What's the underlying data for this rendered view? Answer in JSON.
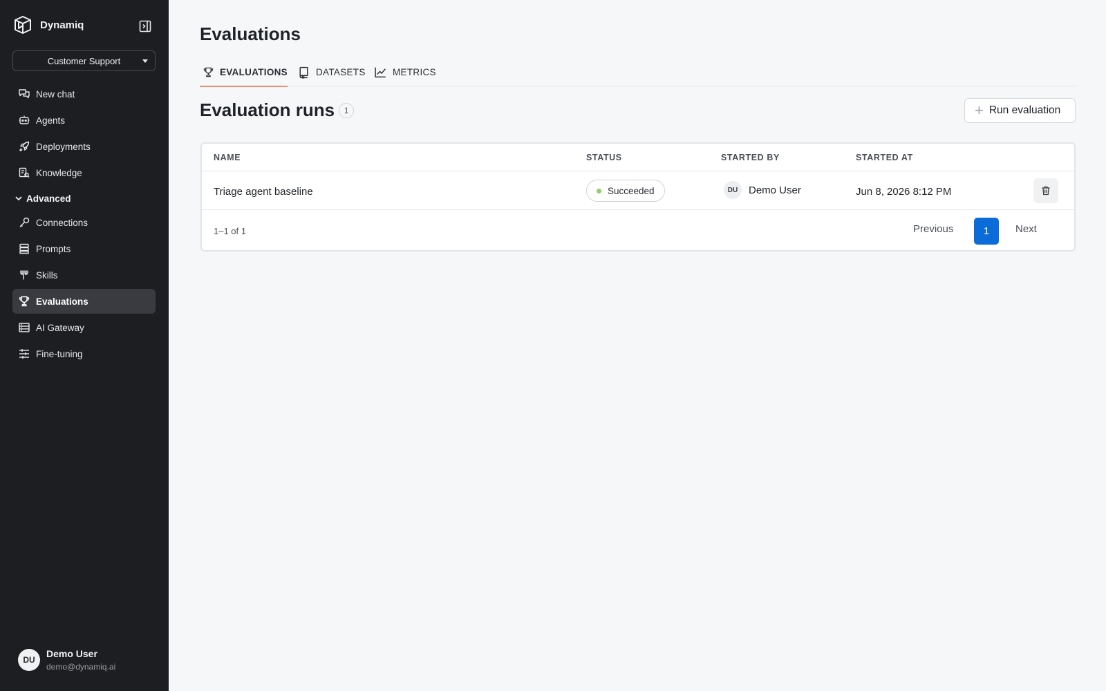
{
  "sidebar": {
    "brand": "Dynamiq",
    "project": "Customer Support",
    "nav_top": [
      {
        "label": "New chat",
        "icon": "chat-icon"
      },
      {
        "label": "Agents",
        "icon": "bot-icon"
      },
      {
        "label": "Deployments",
        "icon": "rocket-icon"
      },
      {
        "label": "Knowledge",
        "icon": "knowledge-icon"
      }
    ],
    "advanced_label": "Advanced",
    "nav_advanced": [
      {
        "label": "Connections",
        "icon": "key-icon"
      },
      {
        "label": "Prompts",
        "icon": "prompts-icon"
      },
      {
        "label": "Skills",
        "icon": "skills-icon"
      },
      {
        "label": "Evaluations",
        "icon": "trophy-icon",
        "active": true
      },
      {
        "label": "AI Gateway",
        "icon": "gateway-icon"
      },
      {
        "label": "Fine-tuning",
        "icon": "sliders-icon"
      }
    ],
    "user": {
      "initials": "DU",
      "name": "Demo User",
      "email": "demo@dynamiq.ai"
    }
  },
  "main": {
    "title": "Evaluations",
    "tabs": [
      {
        "label": "EVALUATIONS",
        "icon": "trophy-icon",
        "active": true
      },
      {
        "label": "DATASETS",
        "icon": "book-icon"
      },
      {
        "label": "METRICS",
        "icon": "chart-line-icon"
      }
    ],
    "section_title": "Evaluation runs",
    "count": "1",
    "run_button": "Run evaluation",
    "table": {
      "columns": [
        "NAME",
        "STATUS",
        "STARTED BY",
        "STARTED AT"
      ],
      "rows": [
        {
          "name": "Triage agent baseline",
          "status": "Succeeded",
          "started_by_initials": "DU",
          "started_by": "Demo User",
          "started_at": "Jun 8, 2026 8:12 PM"
        }
      ],
      "range": "1–1 of 1",
      "prev": "Previous",
      "page": "1",
      "next": "Next"
    }
  },
  "colors": {
    "sidebar_bg": "#1d1e21",
    "accent_tab": "#f08a6c",
    "page_active": "#0b6bd8",
    "status_success": "#8fce6a"
  }
}
